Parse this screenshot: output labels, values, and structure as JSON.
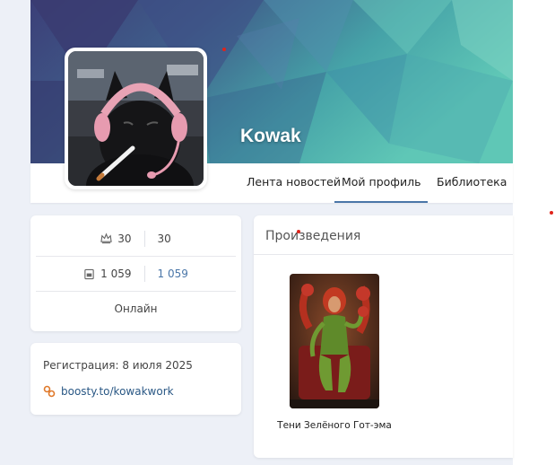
{
  "profile": {
    "username": "Kowak"
  },
  "nav": {
    "tabs": [
      {
        "label": "Лента новостей",
        "active": false
      },
      {
        "label": "Мой профиль",
        "active": true
      },
      {
        "label": "Библиотека",
        "active": false
      }
    ]
  },
  "stats": {
    "row1": {
      "icon": "crown-icon",
      "left": "30",
      "right": "30"
    },
    "row2": {
      "icon": "book-icon",
      "left": "1 059",
      "right": "1 059"
    },
    "status": "Онлайн"
  },
  "info": {
    "registration": "Регистрация: 8 июля 2025",
    "link_icon": "link-icon",
    "link_text": "boosty.to/kowakwork"
  },
  "works": {
    "header": "Произведения",
    "items": [
      {
        "title": "Тени Зелёного Гот-эма"
      }
    ]
  },
  "colors": {
    "accent": "#4a76a8",
    "link": "#2a5885",
    "background": "#edf0f7"
  }
}
